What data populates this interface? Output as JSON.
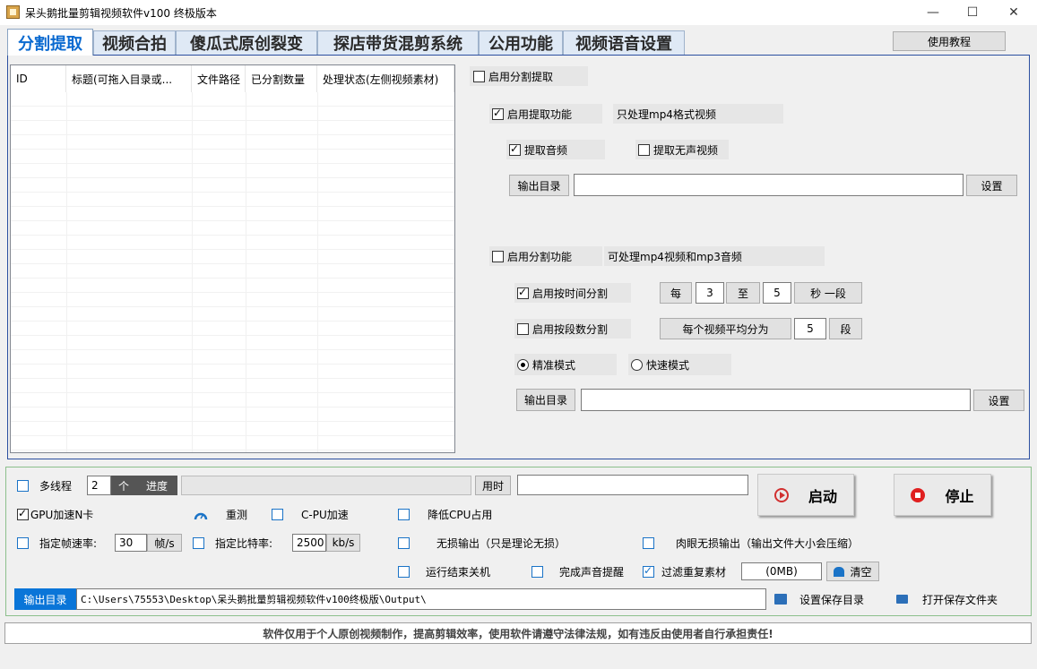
{
  "window": {
    "title": "呆头鹅批量剪辑视频软件v100 终极版本",
    "minimize": "—",
    "maximize": "☐",
    "close": "✕"
  },
  "tabs": [
    {
      "label": "分割提取",
      "active": true
    },
    {
      "label": "视频合拍"
    },
    {
      "label": "傻瓜式原创裂变"
    },
    {
      "label": "探店带货混剪系统"
    },
    {
      "label": "公用功能"
    },
    {
      "label": "视频语音设置"
    }
  ],
  "tutorial_button": "使用教程",
  "table": {
    "columns": [
      "ID",
      "标题(可拖入目录或...",
      "文件路径",
      "已分割数量",
      "处理状态(左侧视频素材)"
    ]
  },
  "extract": {
    "enable_label": "启用分割提取",
    "enable_checked": false,
    "enable_extract_label": "启用提取功能",
    "enable_extract_checked": true,
    "extract_note": "只处理mp4格式视频",
    "extract_audio_label": "提取音频",
    "extract_audio_checked": true,
    "extract_silent_label": "提取无声视频",
    "extract_silent_checked": false,
    "output_dir_button": "输出目录",
    "output_dir_value": "",
    "set_button": "设置"
  },
  "split": {
    "enable_label": "启用分割功能",
    "enable_checked": false,
    "note": "可处理mp4视频和mp3音频",
    "by_time_label": "启用按时间分割",
    "by_time_checked": true,
    "every_label": "每",
    "from_value": "3",
    "to_label": "至",
    "to_value": "5",
    "sec_label": "秒 一段",
    "by_segments_label": "启用按段数分割",
    "by_segments_checked": false,
    "avg_label": "每个视频平均分为",
    "segments_value": "5",
    "seg_label": "段",
    "mode_precise": "精准模式",
    "mode_fast": "快速模式",
    "mode_selected": "precise",
    "output_dir_button": "输出目录",
    "output_dir_value": "",
    "set_button": "设置"
  },
  "bottom": {
    "multithread_label": "多线程",
    "thread_count": "2",
    "thread_unit": "个",
    "progress_label": "进度",
    "progress_fraction": 0,
    "elapsed_button": "用时",
    "elapsed_value": "",
    "start_button": "启动",
    "stop_button": "停止",
    "gpu_label": "GPU加速N卡",
    "gpu_checked": true,
    "retest_label": "重测",
    "cpu_label": "C-PU加速",
    "lowcpu_label": "降低CPU占用",
    "fps_label": "指定帧速率:",
    "fps_value": "30",
    "fps_unit": "帧/s",
    "bitrate_label": "指定比特率:",
    "bitrate_value": "2500",
    "bitrate_unit": "kb/s",
    "lossless_label": "无损输出（只是理论无损）",
    "visual_lossless_label": "肉眼无损输出（输出文件大小会压缩）",
    "shutdown_label": "运行结束关机",
    "sound_label": "完成声音提醒",
    "filter_dup_label": "过滤重复素材",
    "filter_dup_checked": true,
    "cache_size": "(0MB)",
    "clear_button": "清空",
    "output_dir_button": "输出目录",
    "output_path": "C:\\Users\\75553\\Desktop\\呆头鹅批量剪辑视频软件v100终极版\\Output\\",
    "set_save_dir_button": "设置保存目录",
    "open_save_folder_button": "打开保存文件夹"
  },
  "footer": "软件仅用于个人原创视频制作，提高剪辑效率，使用软件请遵守法律法规，如有违反由使用者自行承担责任!"
}
